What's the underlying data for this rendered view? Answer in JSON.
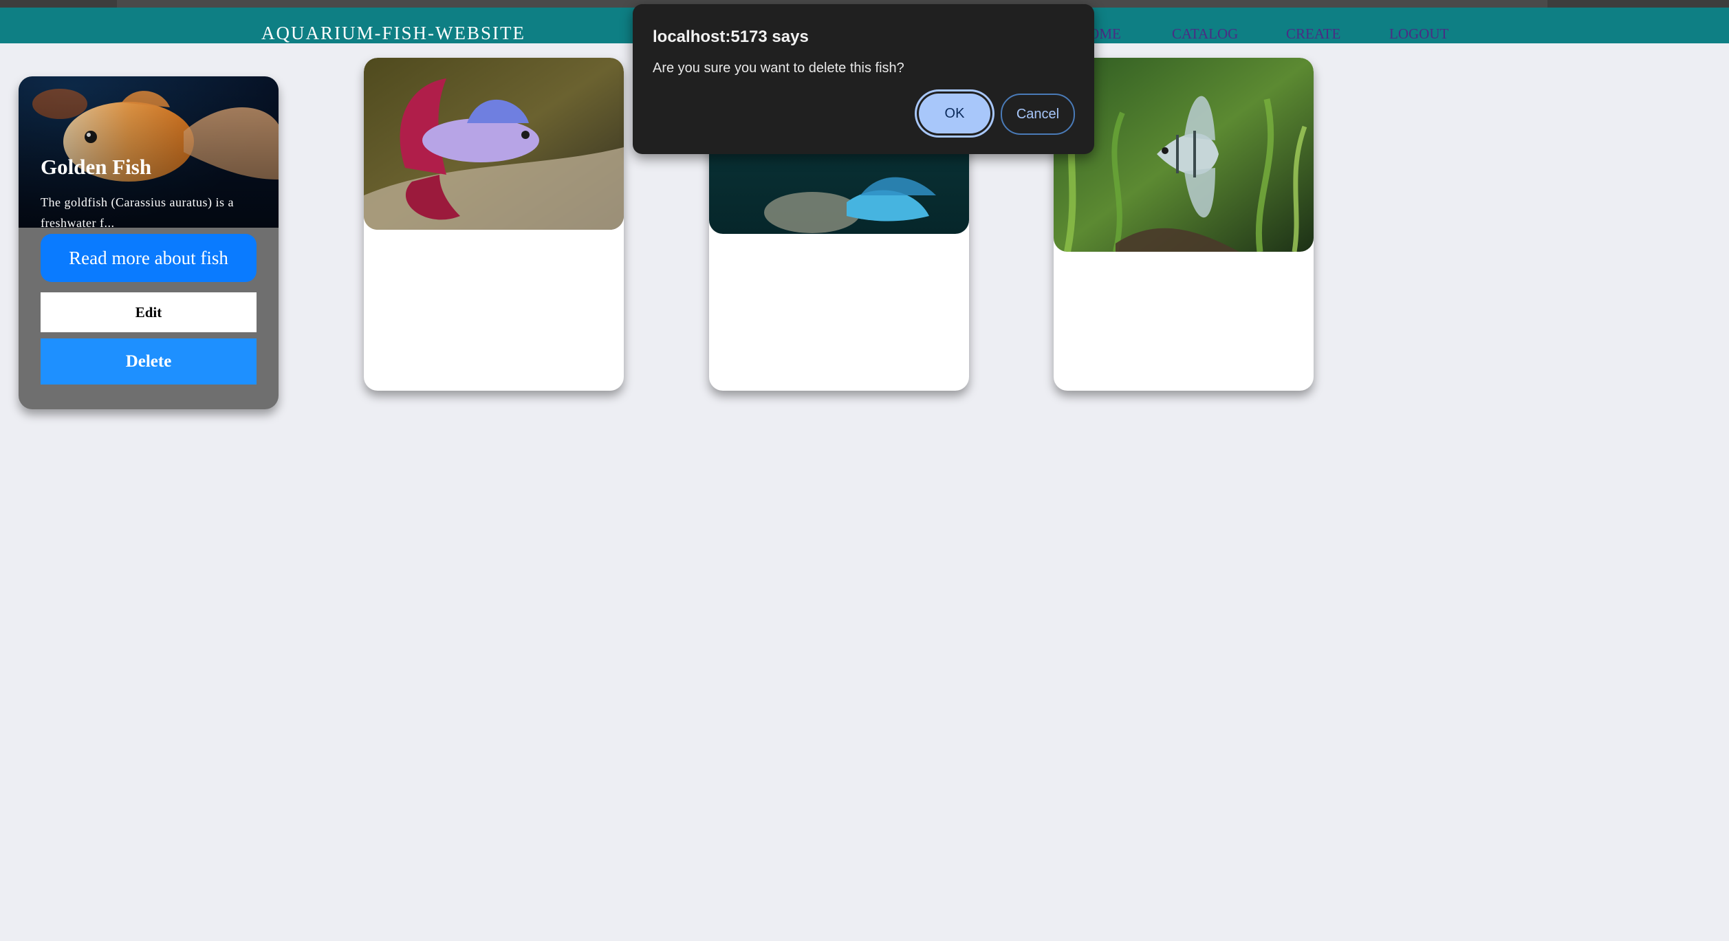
{
  "nav": {
    "title": "AQUARIUM-FISH-WEBSITE",
    "links": [
      "HOME",
      "CATALOG",
      "CREATE",
      "LOGOUT"
    ]
  },
  "featured": {
    "title": "Golden Fish",
    "description": "The goldfish (Carassius auratus) is a freshwater f...",
    "read_more_label": "Read more about fish",
    "edit_label": "Edit",
    "delete_label": "Delete"
  },
  "cards": [
    {
      "image": "betta-fish-photo"
    },
    {
      "image": "blue-tropical-fish-photo"
    },
    {
      "image": "angelfish-photo"
    }
  ],
  "dialog": {
    "title": "localhost:5173 says",
    "message": "Are you sure you want to delete this fish?",
    "ok_label": "OK",
    "cancel_label": "Cancel"
  },
  "colors": {
    "navbar": "#0e7f84",
    "nav_link": "#4b2c84",
    "page_bg": "#edeef3",
    "primary_button": "#0a7bff",
    "delete_button": "#1e90ff",
    "dialog_bg": "#202020",
    "ok_button": "#a8c7fa"
  }
}
